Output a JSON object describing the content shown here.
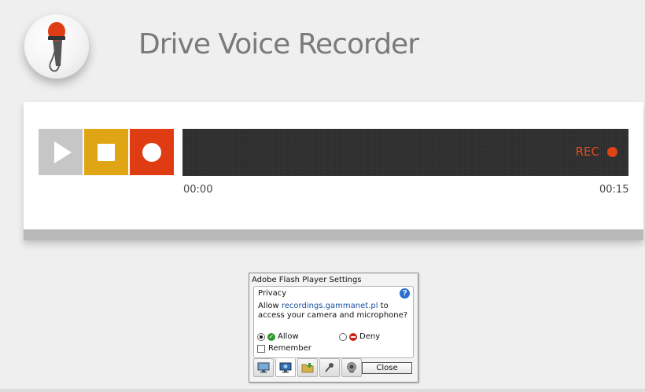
{
  "header": {
    "app_title": "Drive Voice Recorder",
    "logo_icon": "microphone-icon"
  },
  "recorder": {
    "controls": [
      {
        "name": "play",
        "icon": "play-icon",
        "color": "#c6c6c6"
      },
      {
        "name": "stop",
        "icon": "stop-icon",
        "color": "#e0a515"
      },
      {
        "name": "record",
        "icon": "record-icon",
        "color": "#e03c14"
      }
    ],
    "status_label": "REC",
    "time_start": "00:00",
    "time_end": "00:15",
    "track_color": "#2c2c2c",
    "accent_color": "#e44b1f"
  },
  "flash_dialog": {
    "title": "Adobe Flash Player Settings",
    "section_title": "Privacy",
    "text_prefix": "Allow ",
    "domain": "recordings.gammanet.pl",
    "text_suffix": " to access your camera and microphone?",
    "allow_label": "Allow",
    "deny_label": "Deny",
    "selected_option": "Allow",
    "remember_label": "Remember",
    "remember_checked": false,
    "tabs": [
      {
        "icon": "monitor-icon"
      },
      {
        "icon": "privacy-monitor-icon"
      },
      {
        "icon": "folder-icon"
      },
      {
        "icon": "microphone-icon"
      },
      {
        "icon": "webcam-icon"
      }
    ],
    "active_tab": 1,
    "close_label": "Close"
  }
}
